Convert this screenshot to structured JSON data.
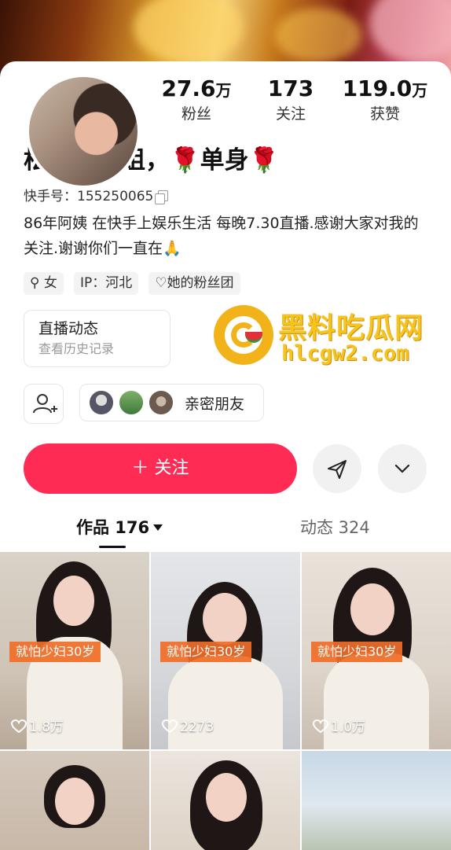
{
  "profile": {
    "name_prefix": "松原大美姐，",
    "rose": "🌹",
    "name_middle": "单身",
    "kuaishou_id": "快手号：155250065",
    "bio": "86年阿姨 在快手上娱乐生活 每晚7.30直播.感谢大家对我的关注.谢谢你们一直在🙏"
  },
  "stats": [
    {
      "num": "27.6",
      "unit": "万",
      "label": "粉丝"
    },
    {
      "num": "173",
      "unit": "",
      "label": "关注"
    },
    {
      "num": "119.0",
      "unit": "万",
      "label": "获赞"
    }
  ],
  "tags": {
    "gender": "女",
    "ip": "IP：河北",
    "fan_group": "她的粉丝团"
  },
  "live_box": {
    "title": "直播动态",
    "subtitle": "查看历史记录"
  },
  "watermark": {
    "title": "黑料吃瓜网",
    "url": "hlcgw2.com"
  },
  "friends": {
    "label": "亲密朋友"
  },
  "actions": {
    "follow_label": "＋ 关注"
  },
  "tabs": {
    "works_label": "作品 176",
    "moments_label": "动态 324"
  },
  "videos": [
    {
      "caption": "就怕少妇30岁",
      "likes": "1.8万"
    },
    {
      "caption": "就怕少妇30岁",
      "likes": "2273"
    },
    {
      "caption": "就怕少妇30岁",
      "likes": "1.0万"
    }
  ],
  "colors": {
    "accent": "#fe2c55",
    "caption_bg": "#f06e28",
    "watermark": "#f5c51e"
  }
}
